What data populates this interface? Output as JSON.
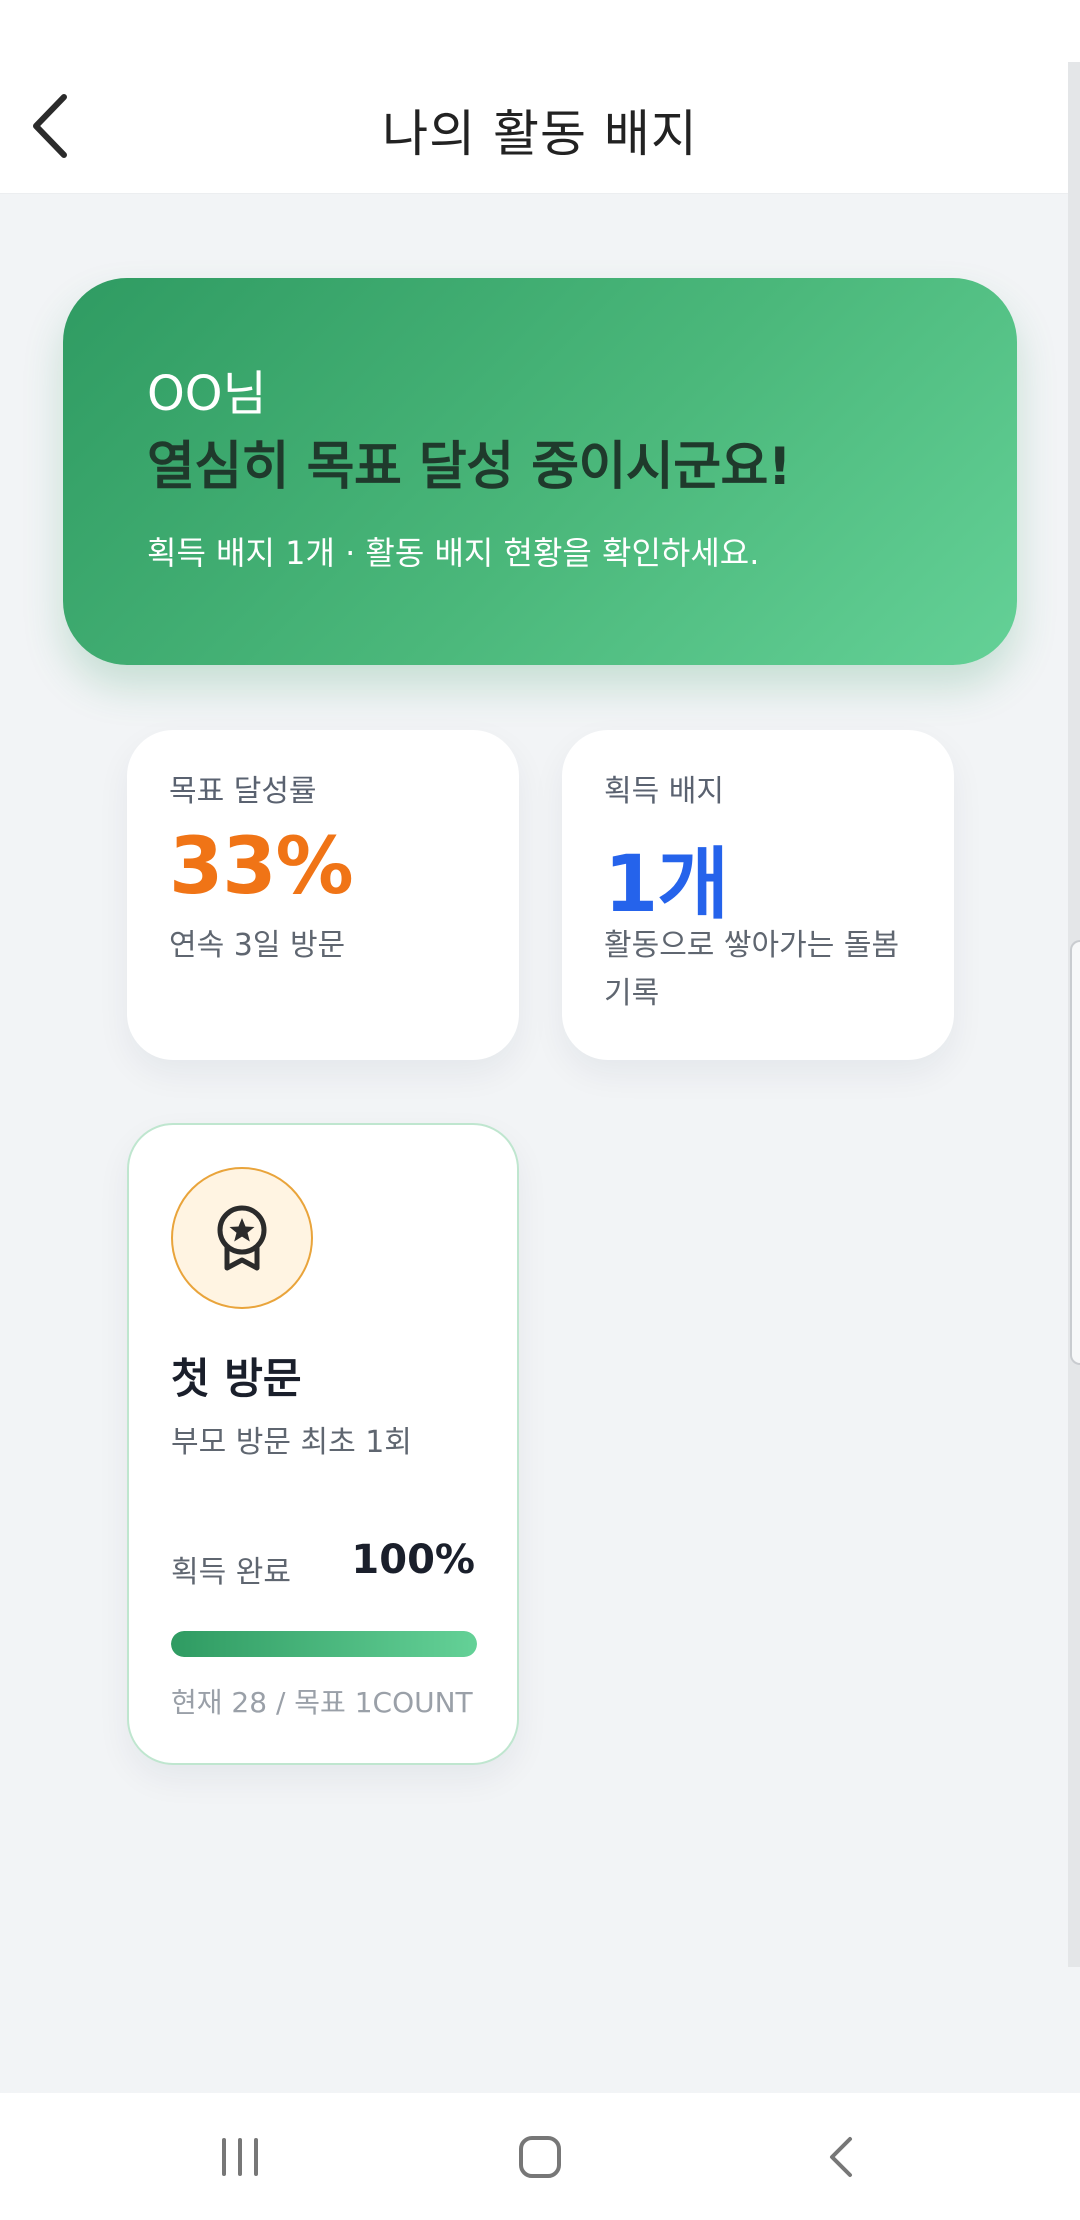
{
  "header": {
    "title": "나의 활동 배지"
  },
  "hero": {
    "name": "OO님",
    "title": "열심히 목표 달성 중이시군요!",
    "subtitle": "획득 배지 1개 · 활동 배지 현황을 확인하세요."
  },
  "stats": [
    {
      "label": "목표 달성률",
      "value": "33%",
      "desc": "연속 3일 방문",
      "color": "#f07416"
    },
    {
      "label": "획득 배지",
      "value": "1개",
      "desc": "활동으로 쌓아가는 돌봄 기록",
      "color": "#2563eb"
    }
  ],
  "badge": {
    "icon": "award-ribbon-icon",
    "title": "첫 방문",
    "desc": "부모 방문 최초 1회",
    "status": "획득 완료",
    "percent_label": "100%",
    "progress": 1.0,
    "footer": "현재 28 / 목표 1COUNT"
  },
  "nav": {
    "icons": [
      "recent-apps-icon",
      "home-icon",
      "back-icon"
    ]
  },
  "colors": {
    "accent_green": "#3fae72",
    "badge_ring": "#e9a43b"
  }
}
